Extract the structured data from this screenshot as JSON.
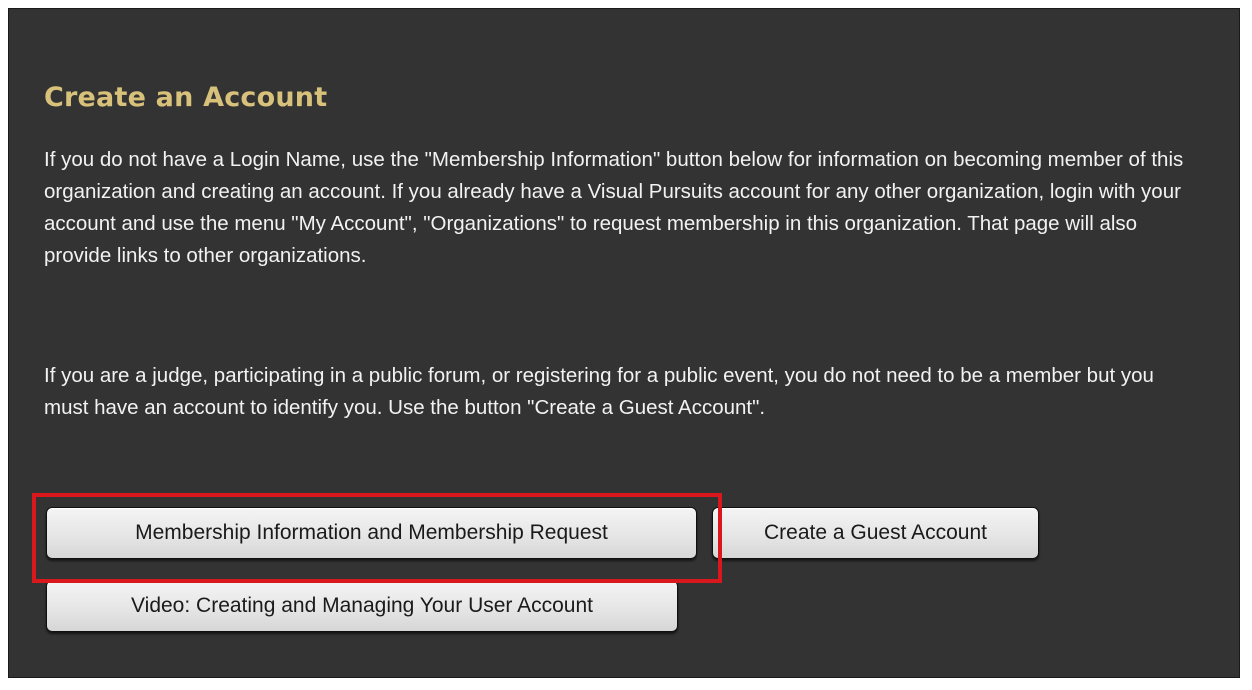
{
  "section": {
    "title": "Create an Account",
    "paragraph_1": "If you do not have a Login Name, use the \"Membership Information\" button below for information on becoming member of this organization and creating an account. If you already have a Visual Pursuits account for any other organization, login with your account and use the menu \"My Account\", \"Organizations\" to request membership in this organization. That page will also provide links to other organizations.",
    "paragraph_2": "If you are a judge, participating in a public forum, or registering for a public event, you do not need to be a member but you must have an account to identify you. Use the button \"Create a Guest Account\"."
  },
  "buttons": {
    "membership_label": "Membership Information and Membership Request",
    "guest_label": "Create a Guest Account",
    "video_label": "Video: Creating and Managing Your User Account"
  },
  "colors": {
    "panel_background": "#333333",
    "title_color": "#d8c17a",
    "text_color": "#f2f2f2",
    "highlight_border": "#d8181c"
  }
}
